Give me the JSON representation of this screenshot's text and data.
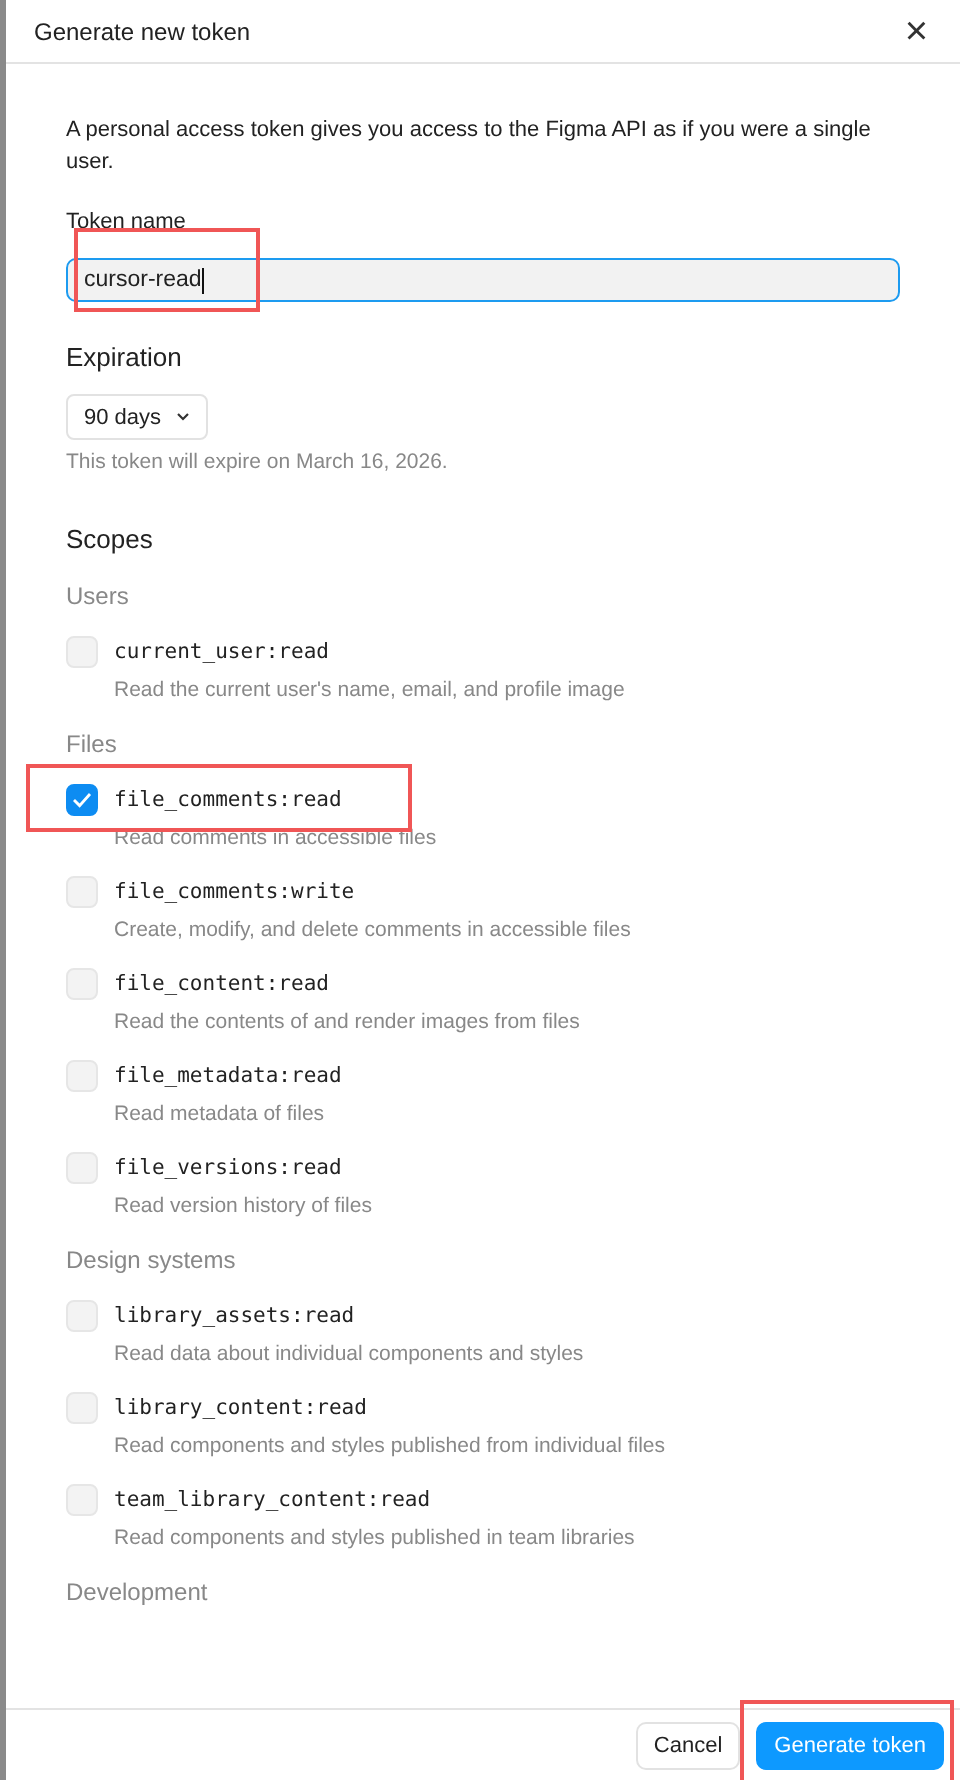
{
  "dialog": {
    "title": "Generate new token",
    "close": "×"
  },
  "intro": "A personal access token gives you access to the Figma API as if you were a single user.",
  "token_name": {
    "label": "Token name",
    "value": "cursor-read",
    "focused": true,
    "highlighted": true
  },
  "expiration": {
    "heading": "Expiration",
    "value": "90 days",
    "note": "This token will expire on March 16, 2026."
  },
  "scopes_heading": "Scopes",
  "groups": [
    {
      "title": "Users",
      "scopes": [
        {
          "name": "current_user:read",
          "description": "Read the current user's name, email, and profile image",
          "checked": false,
          "highlighted": false
        }
      ]
    },
    {
      "title": "Files",
      "scopes": [
        {
          "name": "file_comments:read",
          "description": "Read comments in accessible files",
          "checked": true,
          "highlighted": true
        },
        {
          "name": "file_comments:write",
          "description": "Create, modify, and delete comments in accessible files",
          "checked": false,
          "highlighted": false
        },
        {
          "name": "file_content:read",
          "description": "Read the contents of and render images from files",
          "checked": false,
          "highlighted": false
        },
        {
          "name": "file_metadata:read",
          "description": "Read metadata of files",
          "checked": false,
          "highlighted": false
        },
        {
          "name": "file_versions:read",
          "description": "Read version history of files",
          "checked": false,
          "highlighted": false
        }
      ]
    },
    {
      "title": "Design systems",
      "scopes": [
        {
          "name": "library_assets:read",
          "description": "Read data about individual components and styles",
          "checked": false,
          "highlighted": false
        },
        {
          "name": "library_content:read",
          "description": "Read components and styles published from individual files",
          "checked": false,
          "highlighted": false
        },
        {
          "name": "team_library_content:read",
          "description": "Read components and styles published in team libraries",
          "checked": false,
          "highlighted": false
        }
      ]
    },
    {
      "title": "Development"
    }
  ],
  "buttons": [
    {
      "label": "Cancel",
      "kind": "secondary",
      "highlighted": false
    },
    {
      "label": "Generate token",
      "kind": "primary",
      "highlighted": true
    }
  ]
}
